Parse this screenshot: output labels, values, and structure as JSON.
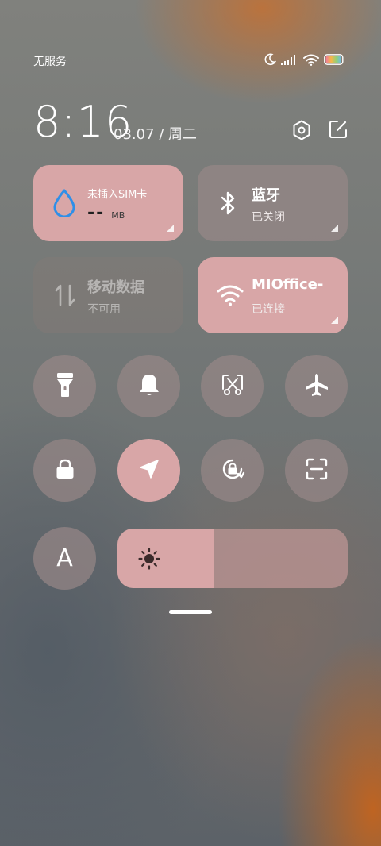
{
  "status_bar": {
    "carrier": "无服务",
    "icons": [
      "moon-icon",
      "signal-icon",
      "wifi-icon",
      "battery-icon"
    ]
  },
  "header": {
    "time": "8:16",
    "date": "03.07 / 周二",
    "icons": [
      "settings-icon",
      "edit-icon"
    ]
  },
  "tiles": {
    "sim": {
      "title": "未插入SIM卡",
      "value": "--",
      "unit": "MB",
      "icon": "water-drop-icon"
    },
    "bluetooth": {
      "title": "蓝牙",
      "status": "已关闭",
      "icon": "bluetooth-icon"
    },
    "mobile_data": {
      "title": "移动数据",
      "status": "不可用",
      "icon": "data-arrows-icon"
    },
    "wifi": {
      "title": "MIOffice-",
      "status": "已连接",
      "icon": "wifi-icon"
    }
  },
  "toggles_row1": [
    "flashlight-icon",
    "bell-icon",
    "screenshot-icon",
    "airplane-icon"
  ],
  "toggles_row2": [
    "lock-icon",
    "location-icon",
    "rotation-lock-icon",
    "scan-icon"
  ],
  "font_button": {
    "label": "A"
  },
  "brightness": {
    "level": 0.42,
    "icon": "sun-icon"
  },
  "colors": {
    "active_tile": "#d8a6a7",
    "inactive_tile": "#968787",
    "accent_drop": "#2f8fe8"
  }
}
